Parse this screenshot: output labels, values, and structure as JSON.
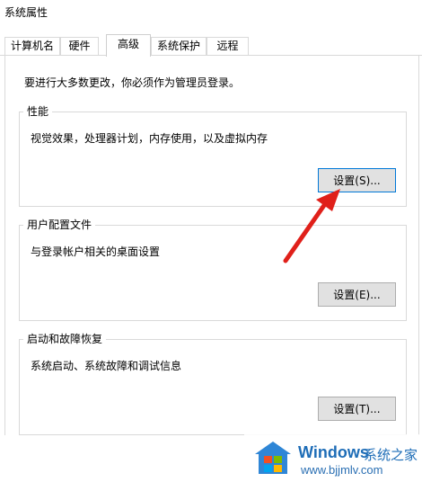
{
  "window": {
    "title": "系统属性"
  },
  "tabs": [
    {
      "label": "计算机名"
    },
    {
      "label": "硬件"
    },
    {
      "label": "高级"
    },
    {
      "label": "系统保护"
    },
    {
      "label": "远程"
    }
  ],
  "notice": "要进行大多数更改，你必须作为管理员登录。",
  "groups": [
    {
      "title": "性能",
      "description": "视觉效果，处理器计划，内存使用，以及虚拟内存",
      "button": "设置(S)..."
    },
    {
      "title": "用户配置文件",
      "description": "与登录帐户相关的桌面设置",
      "button": "设置(E)..."
    },
    {
      "title": "启动和故障恢复",
      "description": "系统启动、系统故障和调试信息",
      "button": "设置(T)..."
    }
  ],
  "watermark": {
    "brand": "Windows",
    "brand_cn": "系统之家",
    "url": "www.bjjmlv.com"
  },
  "colors": {
    "arrow": "#e0201a",
    "focus_border": "#0078d7",
    "button_bg": "#e1e1e1"
  }
}
